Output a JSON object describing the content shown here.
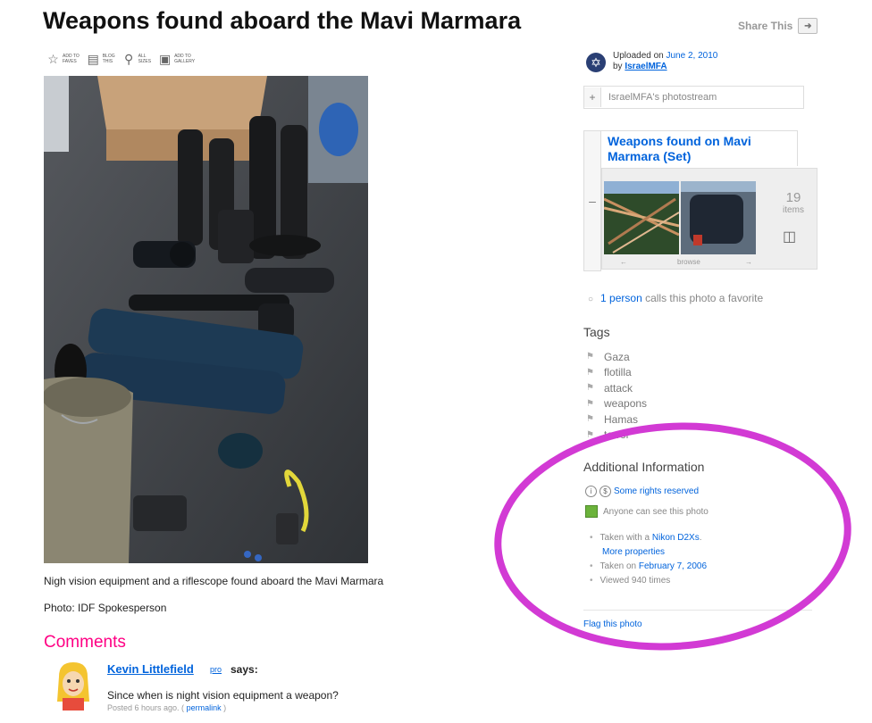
{
  "page": {
    "title": "Weapons found aboard the Mavi Marmara",
    "share_label": "Share This"
  },
  "toolbar": [
    {
      "icon": "star-icon",
      "label_l1": "ADD TO",
      "label_l2": "FAVES"
    },
    {
      "icon": "blog-icon",
      "label_l1": "BLOG",
      "label_l2": "THIS"
    },
    {
      "icon": "magnifier-icon",
      "label_l1": "ALL",
      "label_l2": "SIZES"
    },
    {
      "icon": "gallery-icon",
      "label_l1": "ADD TO",
      "label_l2": "GALLERY"
    }
  ],
  "photo": {
    "caption": "Nigh vision equipment and a riflescope found aboard the Mavi Marmara",
    "credit": "Photo: IDF Spokesperson"
  },
  "comments": {
    "heading": "Comments",
    "items": [
      {
        "author": "Kevin Littlefield",
        "badge": "pro",
        "says": "says:",
        "text": "Since when is night vision equipment a weapon?",
        "posted": "Posted 6 hours ago. (",
        "permalink": "permalink",
        "close": ")"
      }
    ]
  },
  "sidebar": {
    "uploaded_prefix": "Uploaded on",
    "uploaded_date": "June 2, 2010",
    "by_prefix": "by",
    "uploader": "IsraelMFA",
    "photostream_label": "IsraelMFA's photostream",
    "set": {
      "title": "Weapons found on Mavi Marmara (Set)",
      "count": "19",
      "count_label": "items",
      "browse_label": "browse",
      "prev_label": "←",
      "next_label": "→"
    },
    "favorite": {
      "link": "1 person",
      "rest": "calls this photo a favorite"
    },
    "tags_heading": "Tags",
    "tags": [
      "Gaza",
      "flotilla",
      "attack",
      "weapons",
      "Hamas",
      "terror"
    ],
    "additional_heading": "Additional Information",
    "rights_label": "Some rights reserved",
    "visibility_label": "Anyone can see this photo",
    "taken_with_prefix": "Taken with a",
    "camera": "Nikon D2Xs",
    "camera_suffix": ".",
    "more_properties": "More properties",
    "taken_on_prefix": "Taken on",
    "taken_on_date": "February 7, 2006",
    "viewed": "Viewed 940 times",
    "flag_label": "Flag this photo"
  },
  "colors": {
    "link": "#0063dc",
    "comments_heading": "#ff0084",
    "highlight_ellipse": "#d23ad4",
    "visibility_square": "#6bb33b"
  }
}
